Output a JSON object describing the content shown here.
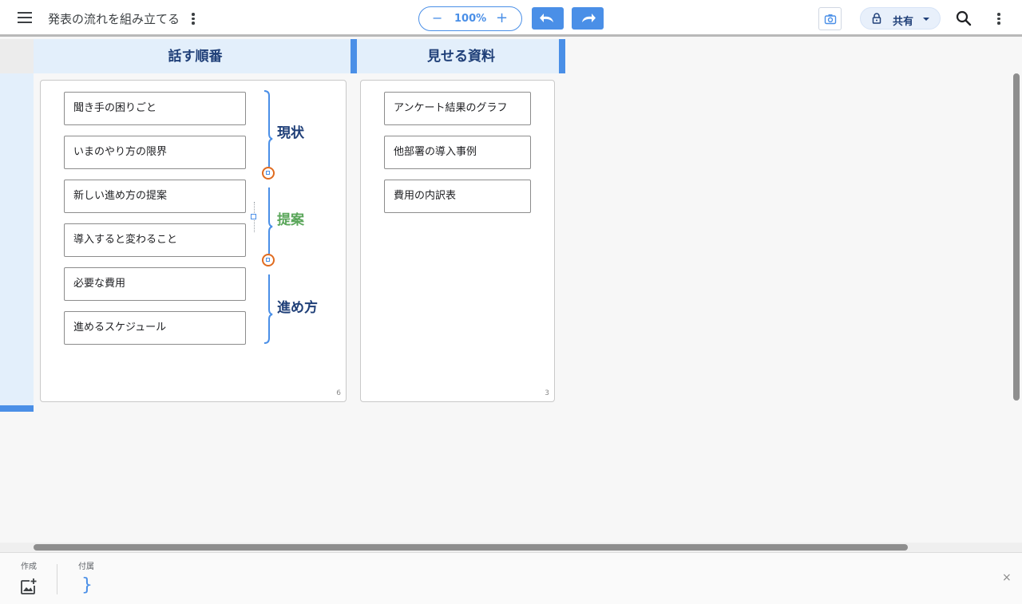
{
  "header": {
    "title": "発表の流れを組み立てる",
    "zoom": "100%",
    "zoom_minus": "−",
    "zoom_plus": "+",
    "share_label": "共有"
  },
  "columns": [
    {
      "title": "話す順番",
      "count": "6"
    },
    {
      "title": "見せる資料",
      "count": "3"
    }
  ],
  "order_cards": [
    "聞き手の困りごと",
    "いまのやり方の限界",
    "新しい進め方の提案",
    "導入すると変わること",
    "必要な費用",
    "進めるスケジュール"
  ],
  "groups": [
    {
      "label": "現状",
      "color": "#1f3f78"
    },
    {
      "label": "提案",
      "color": "#5aa65a"
    },
    {
      "label": "進め方",
      "color": "#1f3f78"
    }
  ],
  "material_cards": [
    "アンケート結果のグラフ",
    "他部署の導入事例",
    "費用の内訳表"
  ],
  "bottom_panel": {
    "create_label": "作成",
    "attach_label": "付属",
    "brace_glyph": "}",
    "close_glyph": "×"
  },
  "colors": {
    "accent": "#4a8fe7",
    "header_text": "#1f3f78",
    "handle": "#e06b1f",
    "proposal": "#5aa65a"
  }
}
